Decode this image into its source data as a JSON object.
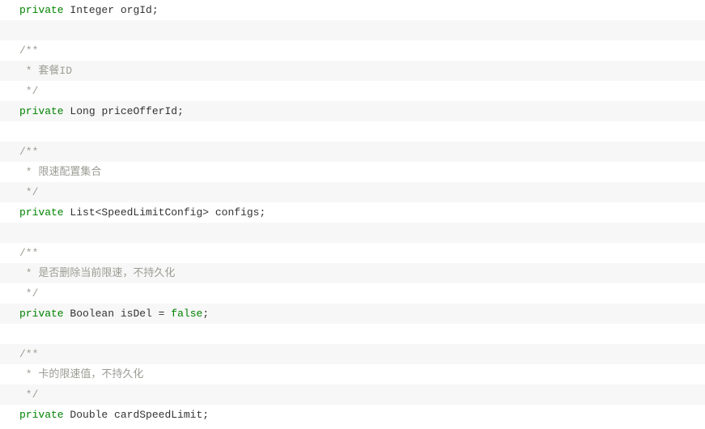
{
  "code": {
    "lines": [
      {
        "tokens": [
          {
            "cls": "kw",
            "bind": "tok.private"
          },
          {
            "cls": "",
            "bind": "tok.sp"
          },
          {
            "cls": "type",
            "bind": "tok.integer"
          },
          {
            "cls": "",
            "bind": "tok.sp"
          },
          {
            "cls": "ident",
            "bind": "tok.orgId"
          },
          {
            "cls": "punct",
            "bind": "tok.semi"
          }
        ]
      },
      {
        "tokens": []
      },
      {
        "tokens": [
          {
            "cls": "cmt",
            "bind": "tok.docOpen"
          }
        ]
      },
      {
        "tokens": [
          {
            "cls": "cmt",
            "bind": "tok.star"
          },
          {
            "cls": "",
            "bind": "tok.sp"
          },
          {
            "cls": "cmt",
            "bind": "tok.comment1"
          }
        ]
      },
      {
        "tokens": [
          {
            "cls": "cmt",
            "bind": "tok.docClose"
          }
        ]
      },
      {
        "tokens": [
          {
            "cls": "kw",
            "bind": "tok.private"
          },
          {
            "cls": "",
            "bind": "tok.sp"
          },
          {
            "cls": "type",
            "bind": "tok.long"
          },
          {
            "cls": "",
            "bind": "tok.sp"
          },
          {
            "cls": "ident",
            "bind": "tok.priceOfferId"
          },
          {
            "cls": "punct",
            "bind": "tok.semi"
          }
        ]
      },
      {
        "tokens": []
      },
      {
        "tokens": [
          {
            "cls": "cmt",
            "bind": "tok.docOpen"
          }
        ]
      },
      {
        "tokens": [
          {
            "cls": "cmt",
            "bind": "tok.star"
          },
          {
            "cls": "",
            "bind": "tok.sp"
          },
          {
            "cls": "cmt",
            "bind": "tok.comment2"
          }
        ]
      },
      {
        "tokens": [
          {
            "cls": "cmt",
            "bind": "tok.docClose"
          }
        ]
      },
      {
        "tokens": [
          {
            "cls": "kw",
            "bind": "tok.private"
          },
          {
            "cls": "",
            "bind": "tok.sp"
          },
          {
            "cls": "type",
            "bind": "tok.listType"
          },
          {
            "cls": "",
            "bind": "tok.sp"
          },
          {
            "cls": "ident",
            "bind": "tok.configs"
          },
          {
            "cls": "punct",
            "bind": "tok.semi"
          }
        ]
      },
      {
        "tokens": []
      },
      {
        "tokens": [
          {
            "cls": "cmt",
            "bind": "tok.docOpen"
          }
        ]
      },
      {
        "tokens": [
          {
            "cls": "cmt",
            "bind": "tok.star"
          },
          {
            "cls": "",
            "bind": "tok.sp"
          },
          {
            "cls": "cmt",
            "bind": "tok.comment3"
          }
        ]
      },
      {
        "tokens": [
          {
            "cls": "cmt",
            "bind": "tok.docClose"
          }
        ]
      },
      {
        "tokens": [
          {
            "cls": "kw",
            "bind": "tok.private"
          },
          {
            "cls": "",
            "bind": "tok.sp"
          },
          {
            "cls": "type",
            "bind": "tok.boolean"
          },
          {
            "cls": "",
            "bind": "tok.sp"
          },
          {
            "cls": "ident",
            "bind": "tok.isDel"
          },
          {
            "cls": "",
            "bind": "tok.sp"
          },
          {
            "cls": "punct",
            "bind": "tok.eq"
          },
          {
            "cls": "",
            "bind": "tok.sp"
          },
          {
            "cls": "val",
            "bind": "tok.false"
          },
          {
            "cls": "punct",
            "bind": "tok.semi"
          }
        ]
      },
      {
        "tokens": []
      },
      {
        "tokens": [
          {
            "cls": "cmt",
            "bind": "tok.docOpen"
          }
        ]
      },
      {
        "tokens": [
          {
            "cls": "cmt",
            "bind": "tok.star"
          },
          {
            "cls": "",
            "bind": "tok.sp"
          },
          {
            "cls": "cmt",
            "bind": "tok.comment4"
          }
        ]
      },
      {
        "tokens": [
          {
            "cls": "cmt",
            "bind": "tok.docClose"
          }
        ]
      },
      {
        "tokens": [
          {
            "cls": "kw",
            "bind": "tok.private"
          },
          {
            "cls": "",
            "bind": "tok.sp"
          },
          {
            "cls": "type",
            "bind": "tok.double"
          },
          {
            "cls": "",
            "bind": "tok.sp"
          },
          {
            "cls": "ident",
            "bind": "tok.cardSpeedLimit"
          },
          {
            "cls": "punct",
            "bind": "tok.semi"
          }
        ]
      }
    ]
  },
  "tok": {
    "private": "private",
    "integer": "Integer",
    "long": "Long",
    "boolean": "Boolean",
    "double": "Double",
    "listType": "List<SpeedLimitConfig>",
    "orgId": "orgId",
    "priceOfferId": "priceOfferId",
    "configs": "configs",
    "isDel": "isDel",
    "cardSpeedLimit": "cardSpeedLimit",
    "false": "false",
    "semi": ";",
    "eq": "=",
    "sp": " ",
    "docOpen": "/**",
    "docClose": " */",
    "star": " *",
    "comment1": "套餐ID",
    "comment2": "限速配置集合",
    "comment3": "是否删除当前限速，不持久化",
    "comment4": "卡的限速值，不持久化"
  }
}
